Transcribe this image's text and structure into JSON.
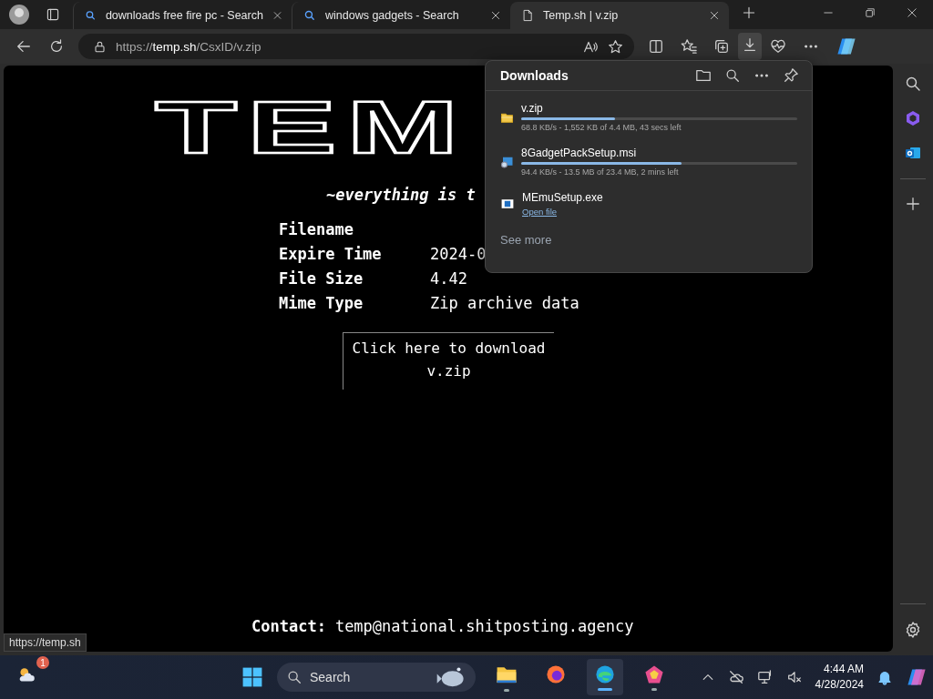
{
  "browser": {
    "tabs": [
      {
        "title": "downloads free fire pc - Search",
        "kind": "search",
        "selected": false
      },
      {
        "title": "windows gadgets - Search",
        "kind": "search",
        "selected": false
      },
      {
        "title": "Temp.sh | v.zip",
        "kind": "page",
        "selected": true
      }
    ],
    "address": "https://**temp.sh**/CsxID/v.zip"
  },
  "page": {
    "logo": "TEM",
    "tagline": "~everything is t",
    "details": [
      {
        "label": "Filename"
      },
      {
        "label": "Expire Time",
        "value": "2024-0"
      },
      {
        "label": "File Size",
        "value": "4.42"
      },
      {
        "label": "Mime Type",
        "value": "Zip archive data"
      }
    ],
    "download_button": "Click here to download v.zip",
    "contact_label": "Contact:",
    "contact_email": "temp@national.shitposting.agency"
  },
  "downloads_panel": {
    "title": "Downloads",
    "items": [
      {
        "kind": "archive",
        "name": "v.zip",
        "level": 0.34,
        "status": "68.8 KB/s - 1,552 KB of 4.4 MB, 43 secs left"
      },
      {
        "kind": "installer",
        "name": "8GadgetPackSetup.msi",
        "level": 0.58,
        "status": "94.4 KB/s - 13.5 MB of 23.4 MB, 2 mins left"
      },
      {
        "kind": "program",
        "name": "MEmuSetup.exe",
        "action": "Open file"
      }
    ],
    "see_more": "See more"
  },
  "status_url": "https://temp.sh",
  "taskbar": {
    "weather_badge": "1",
    "search_label": "Search",
    "apps": [
      {
        "kind": "files",
        "running": true,
        "selected": false
      },
      {
        "kind": "firefox",
        "running": false,
        "selected": false
      },
      {
        "kind": "edge",
        "running": true,
        "selected": true
      },
      {
        "kind": "gem",
        "running": true,
        "selected": false
      }
    ],
    "time": "4:44 AM",
    "date": "4/28/2024"
  }
}
